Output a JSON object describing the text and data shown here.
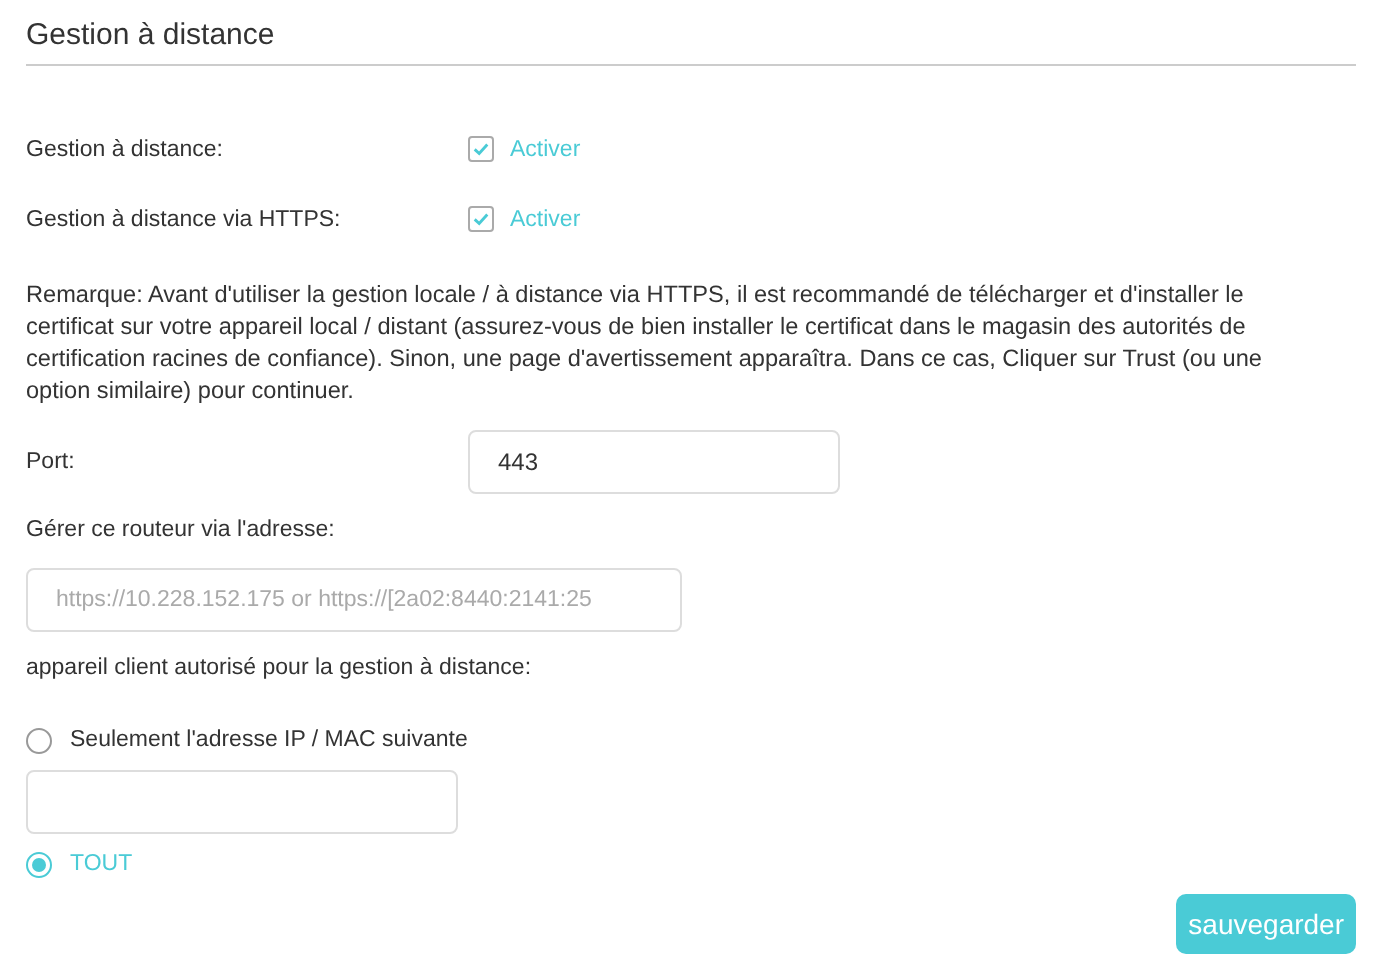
{
  "title": "Gestion à distance",
  "toggles": [
    {
      "label": "Gestion à distance:",
      "checked": true,
      "option": "Activer"
    },
    {
      "label": "Gestion à distance via HTTPS:",
      "checked": true,
      "option": "Activer"
    }
  ],
  "note": "Remarque: Avant d'utiliser la gestion locale / à distance via HTTPS, il est recommandé de télécharger et d'installer le certificat sur votre appareil local / distant (assurez-vous de bien installer le certificat dans le magasin des autorités de certification racines de confiance). Sinon, une page d'avertissement apparaîtra. Dans ce cas, Cliquer sur Trust (ou une option similaire) pour continuer.",
  "port": {
    "label": "Port:",
    "value": "443"
  },
  "address": {
    "label": "Gérer ce routeur via l'adresse:",
    "value": "https://10.228.152.175 or https://[2a02:8440:2141:25",
    "disabled": true
  },
  "clients": {
    "label": "appareil client autorisé pour la gestion à distance:",
    "options": [
      {
        "label": "Seulement l'adresse IP / MAC suivante",
        "selected": false,
        "kind": "with-field"
      },
      {
        "label": "TOUT",
        "selected": true,
        "kind": "plain"
      }
    ]
  },
  "save_button": "sauvegarder"
}
